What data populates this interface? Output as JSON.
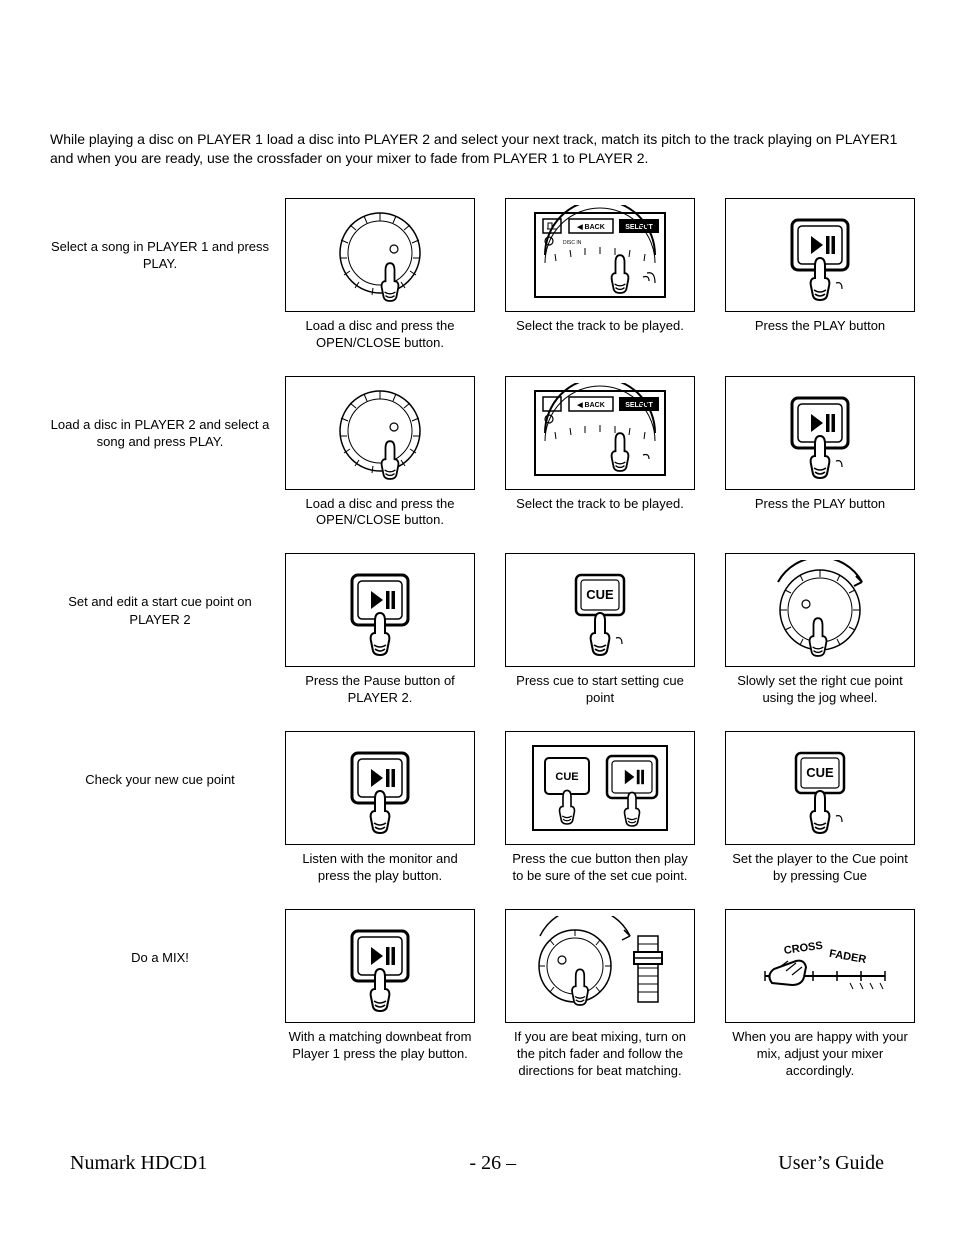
{
  "intro": "While playing a disc on PLAYER 1 load a disc into PLAYER 2 and select your next track, match its pitch to the track playing on PLAYER1 and when you are ready, use the crossfader on your mixer to fade from PLAYER 1 to PLAYER 2.",
  "rows": {
    "r1": {
      "label": "Select a song in PLAYER 1 and press PLAY.",
      "c1": "Load a disc and press the OPEN/CLOSE button.",
      "c2": "Select the track to be played.",
      "c3": "Press the PLAY button"
    },
    "r2": {
      "label": "Load a disc in PLAYER 2 and select a song and press PLAY.",
      "c1": "Load a disc and press the OPEN/CLOSE button.",
      "c2": "Select the track to be played.",
      "c3": "Press the PLAY button"
    },
    "r3": {
      "label": "Set and edit a start cue point on PLAYER 2",
      "c1": "Press the Pause button of PLAYER 2.",
      "c2": "Press cue to start setting cue  point",
      "c3": "Slowly set the right cue point using the jog wheel."
    },
    "r4": {
      "label": "Check your new cue point",
      "c1": "Listen with the monitor and press the play button.",
      "c2": "Press the cue button then play to be sure of the set cue point.",
      "c3": "Set the player to the Cue point by pressing Cue"
    },
    "r5": {
      "label": "Do a MIX!",
      "c1": "With a matching downbeat from Player 1 press the play button.",
      "c2": "If you are beat mixing, turn on the pitch fader and follow the directions for beat matching.",
      "c3": "When you are happy with your mix, adjust your mixer accordingly."
    }
  },
  "footer": {
    "left": "Numark HDCD1",
    "center": "- 26 –",
    "right": "User’s Guide"
  }
}
